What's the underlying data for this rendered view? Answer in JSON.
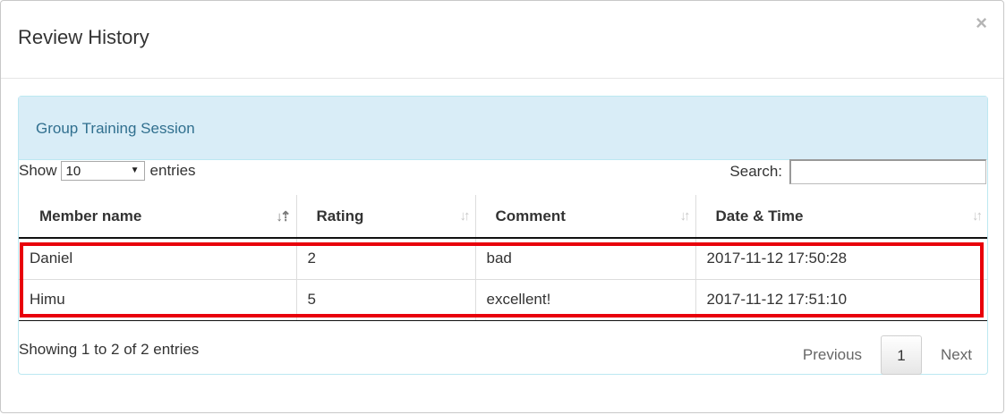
{
  "modal": {
    "title": "Review History",
    "close_label": "×"
  },
  "panel": {
    "title": "Group Training Session"
  },
  "length": {
    "show_label": "Show",
    "selected": "10",
    "entries_label": "entries"
  },
  "search": {
    "label": "Search:",
    "value": ""
  },
  "table": {
    "columns": [
      "Member name",
      "Rating",
      "Comment",
      "Date & Time"
    ],
    "rows": [
      [
        "Daniel",
        "2",
        "bad",
        "2017-11-12 17:50:28"
      ],
      [
        "Himu",
        "5",
        "excellent!",
        "2017-11-12 17:51:10"
      ]
    ],
    "sorted_column": "Member name",
    "sort_direction": "ascending"
  },
  "footer": {
    "info": "Showing 1 to 2 of 2 entries",
    "previous_label": "Previous",
    "current_page": "1",
    "next_label": "Next"
  },
  "colors": {
    "panel_heading_bg": "#d9edf7",
    "panel_title": "#31708f",
    "highlight_border": "#e8000b"
  }
}
